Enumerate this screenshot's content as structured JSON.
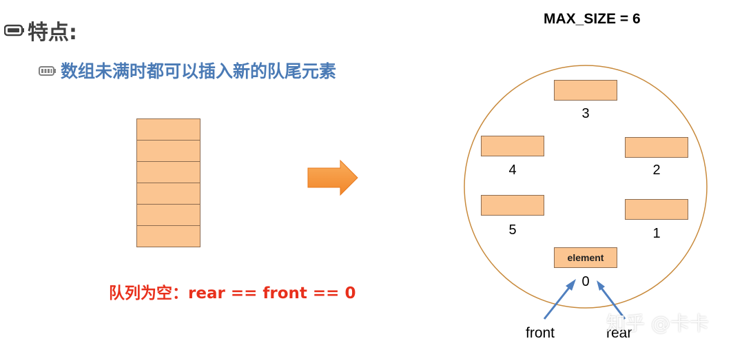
{
  "heading": {
    "text": "特点:"
  },
  "bullet": {
    "text": "数组未满时都可以插入新的队尾元素"
  },
  "empty_caption": {
    "text": "队列为空：rear == front == 0"
  },
  "max_size": {
    "text": "MAX_SIZE = 6"
  },
  "ring": {
    "slot_0_label": "element",
    "indices": [
      "0",
      "1",
      "2",
      "3",
      "4",
      "5"
    ]
  },
  "pointers": {
    "front": "front",
    "rear": "rear"
  },
  "watermark": {
    "text": "知乎 @卡卡"
  },
  "colors": {
    "cell_fill": "#fbc591",
    "cell_border": "#8c6b4f",
    "heading": "#404040",
    "bullet": "#4a7ab5",
    "caption_red": "#e8301c",
    "circle": "#c88a3c",
    "pointer_arrow": "#4f7fbf",
    "big_arrow": "#f59a3a"
  }
}
